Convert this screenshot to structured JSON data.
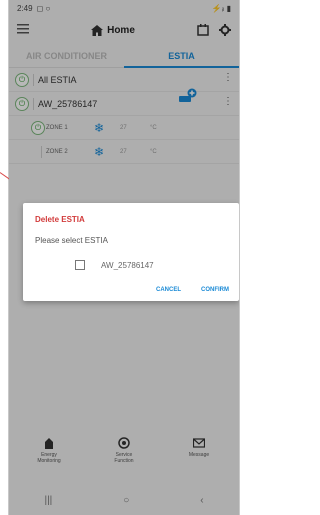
{
  "status": {
    "time": "2:49",
    "indicators": "◻ ○",
    "signal": "⚡ᵢₗ ▮"
  },
  "appbar": {
    "title": "Home",
    "menu_icon": "menu-icon",
    "calendar_icon": "calendar-icon",
    "settings_icon": "gear-icon"
  },
  "tabs": [
    {
      "label": "AIR CONDITIONER",
      "active": false
    },
    {
      "label": "ESTIA",
      "active": true
    }
  ],
  "list": {
    "all_label": "All ESTIA",
    "device": "AW_25786147",
    "zones": [
      {
        "name": "ZONE 1",
        "value": "27",
        "unit": "°C"
      },
      {
        "name": "ZONE 2",
        "value": "27",
        "unit": "°C"
      }
    ]
  },
  "dialog": {
    "title": "Delete ESTIA",
    "subtitle": "Please select ESTIA",
    "option_label": "AW_25786147",
    "cancel": "CANCEL",
    "confirm": "CONFIRM"
  },
  "bottom_nav": [
    {
      "label": "Energy\nMonitoring"
    },
    {
      "label": "Service\nFunction"
    },
    {
      "label": "Message"
    }
  ],
  "colors": {
    "accent": "#1a8ad6",
    "danger": "#d23b3b"
  }
}
